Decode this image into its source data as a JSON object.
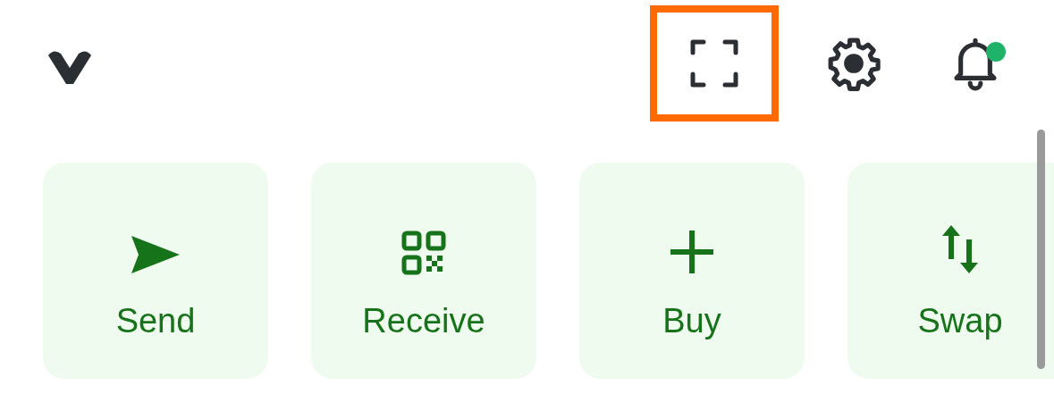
{
  "header": {
    "icons": [
      {
        "kind": "scan",
        "highlighted": true,
        "notification_dot": false
      },
      {
        "kind": "settings",
        "highlighted": false,
        "notification_dot": false
      },
      {
        "kind": "notifications",
        "highlighted": false,
        "notification_dot": true
      }
    ]
  },
  "actions": [
    {
      "kind": "send",
      "label": "Send"
    },
    {
      "kind": "receive",
      "label": "Receive"
    },
    {
      "kind": "buy",
      "label": "Buy"
    },
    {
      "kind": "swap",
      "label": "Swap"
    }
  ]
}
